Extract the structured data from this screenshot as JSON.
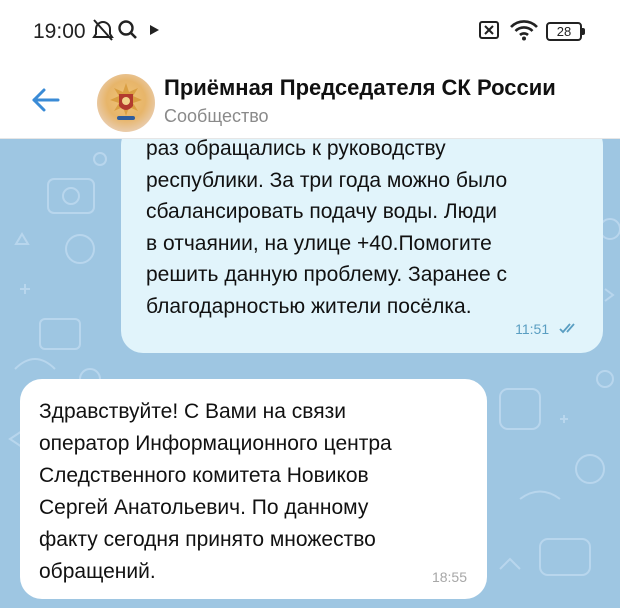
{
  "status_bar": {
    "time": "19:00",
    "battery": "28",
    "icons": [
      "alarm-off-icon",
      "search-icon",
      "play-icon",
      "sim-off-icon",
      "wifi-icon",
      "battery-icon"
    ]
  },
  "header": {
    "title": "Приёмная Председателя СК России",
    "subtitle": "Сообщество",
    "back_icon": "back-arrow-icon",
    "avatar": "investigative-committee-emblem"
  },
  "messages": [
    {
      "direction": "outgoing",
      "text": "раз обращались к руководству\nреспублики. За три года можно было\nсбалансировать подачу воды. Люди\nв отчаянии, на улице +40.Помогите\nрешить данную проблему. Заранее с\nблагодарностью жители посёлка.",
      "time": "11:51",
      "status": "read"
    },
    {
      "direction": "incoming",
      "text": "Здравствуйте! С Вами на связи\nоператор Информационного центра\nСледственного комитета Новиков\nСергей Анатольевич. По данному\nфакту сегодня принято множество\nобращений.",
      "time": "18:55"
    }
  ],
  "colors": {
    "chat_background": "#9ec6e2",
    "outgoing_bubble": "#e1f4fb",
    "incoming_bubble": "#ffffff",
    "read_check": "#5a9ec2"
  }
}
